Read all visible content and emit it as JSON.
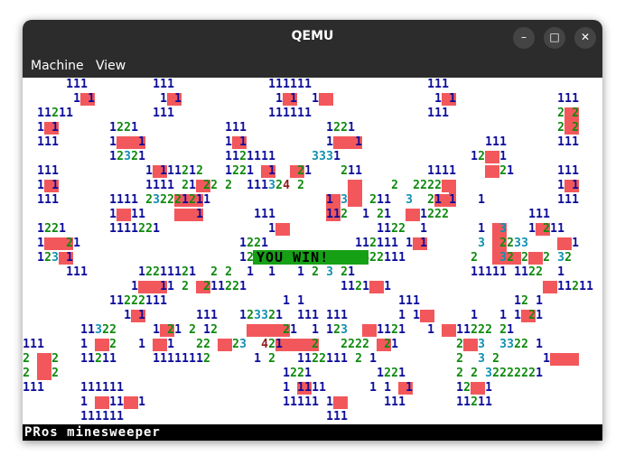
{
  "window": {
    "title": "QEMU",
    "minimize_label": "–",
    "maximize_label": "□",
    "close_label": "✕"
  },
  "menubar": {
    "items": [
      "Machine",
      "View"
    ]
  },
  "game": {
    "banner_text": "YOU WIN!",
    "status_text": "PRos minesweeper",
    "colors": {
      "one": "#0a0a9a",
      "two": "#0e8a0e",
      "three": "#1090b0",
      "four": "#8a1a1a",
      "mine": "#f2585b"
    }
  }
}
